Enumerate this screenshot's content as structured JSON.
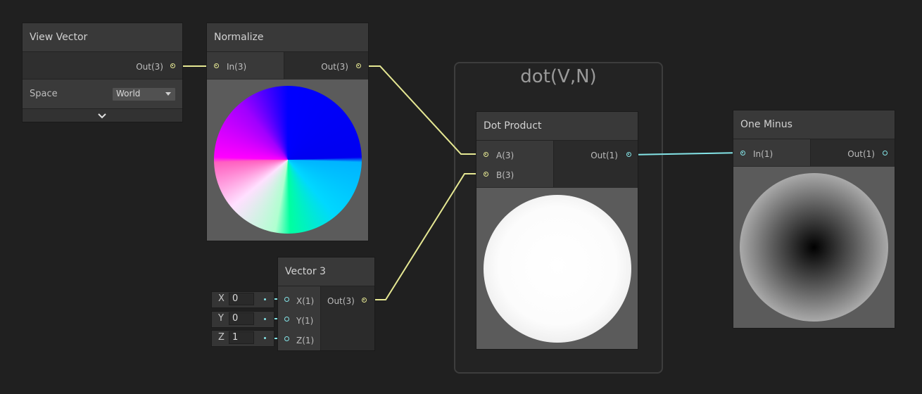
{
  "colors": {
    "vector3_wire": "#e6e893",
    "float_wire": "#84e4e7",
    "node_bg": "#2b2b2b",
    "header_bg": "#393939",
    "canvas_bg": "#202020"
  },
  "group": {
    "title": "dot(V,N)"
  },
  "view_vector": {
    "title": "View Vector",
    "out_label": "Out(3)",
    "space_label": "Space",
    "space_value": "World"
  },
  "normalize": {
    "title": "Normalize",
    "in_label": "In(3)",
    "out_label": "Out(3)"
  },
  "vector3": {
    "title": "Vector 3",
    "x_label": "X(1)",
    "y_label": "Y(1)",
    "z_label": "Z(1)",
    "out_label": "Out(3)",
    "fields": [
      {
        "axis": "X",
        "value": "0"
      },
      {
        "axis": "Y",
        "value": "0"
      },
      {
        "axis": "Z",
        "value": "1"
      }
    ]
  },
  "dot_product": {
    "title": "Dot Product",
    "a_label": "A(3)",
    "b_label": "B(3)",
    "out_label": "Out(1)"
  },
  "one_minus": {
    "title": "One Minus",
    "in_label": "In(1)",
    "out_label": "Out(1)"
  }
}
